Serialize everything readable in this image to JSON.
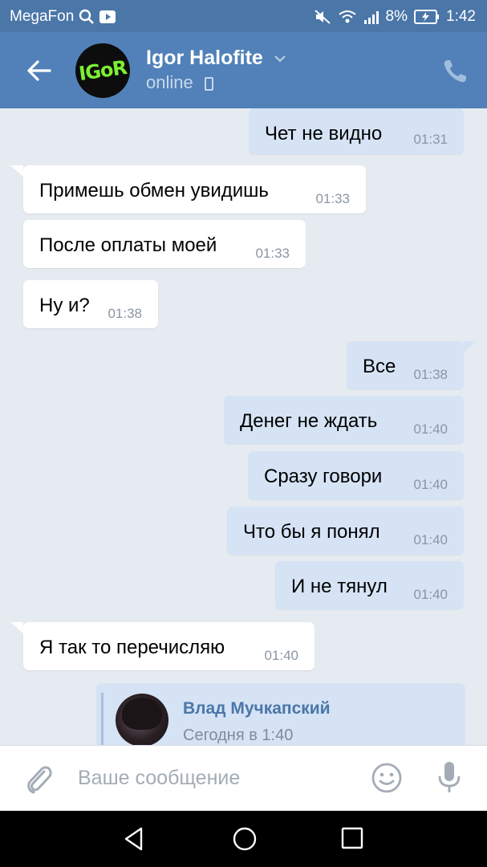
{
  "statusbar": {
    "carrier": "MegaFon",
    "battery": "8%",
    "time": "1:42"
  },
  "header": {
    "contact_name": "Igor Halofite",
    "status": "online",
    "avatar_text": "IGoR"
  },
  "messages": [
    {
      "dir": "out",
      "text": "Чет не видно",
      "time": "01:31"
    },
    {
      "dir": "in",
      "text": "Примешь обмен увидишь",
      "time": "01:33"
    },
    {
      "dir": "in",
      "text": "После оплаты моей",
      "time": "01:33"
    },
    {
      "dir": "in",
      "text": "Ну и?",
      "time": "01:38"
    },
    {
      "dir": "out",
      "text": "Все",
      "time": "01:38"
    },
    {
      "dir": "out",
      "text": "Денег не ждать",
      "time": "01:40"
    },
    {
      "dir": "out",
      "text": "Сразу говори",
      "time": "01:40"
    },
    {
      "dir": "out",
      "text": "Что бы я понял",
      "time": "01:40"
    },
    {
      "dir": "out",
      "text": "И не тянул",
      "time": "01:40"
    },
    {
      "dir": "in",
      "text": "Я так то перечисляю",
      "time": "01:40"
    }
  ],
  "repost": {
    "author": "Влад Мучкапский",
    "date": "Сегодня в 1:40"
  },
  "composer": {
    "placeholder": "Ваше сообщение"
  },
  "icons": {
    "back": "arrow-left-icon",
    "call": "phone-icon",
    "attach": "paperclip-icon",
    "emoji": "smile-icon",
    "voice": "microphone-icon"
  },
  "colors": {
    "header_bg": "#5181b8",
    "statusbar_bg": "#4a76a8",
    "chat_bg": "#e6ebf1",
    "outgoing_bubble": "#d5e3f5",
    "incoming_bubble": "#ffffff",
    "link": "#4a76a8"
  }
}
